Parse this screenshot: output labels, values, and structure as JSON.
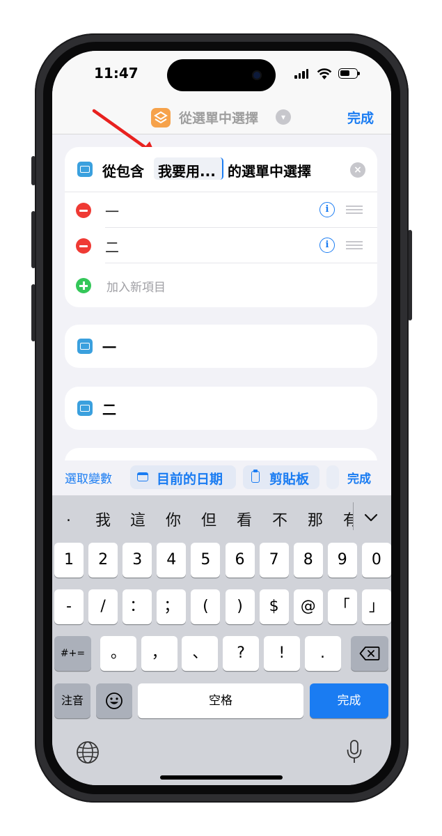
{
  "status_bar": {
    "time": "11:47"
  },
  "nav": {
    "title": "從選單中選擇",
    "done": "完成"
  },
  "header_card": {
    "prefix": "從包含",
    "variable": "我要用...",
    "suffix": "的選單中選擇"
  },
  "menu_items": [
    "一",
    "二"
  ],
  "add_item": "加入新項目",
  "section_cards": [
    "一",
    "二"
  ],
  "toolbar": {
    "select_variable": "選取變數",
    "current_date": "目前的日期",
    "clipboard": "剪貼板",
    "done": "完成"
  },
  "candidates": [
    ".",
    "我",
    "這",
    "你",
    "但",
    "看",
    "不",
    "那",
    "有"
  ],
  "keys": {
    "row1": [
      "1",
      "2",
      "3",
      "4",
      "5",
      "6",
      "7",
      "8",
      "9",
      "0"
    ],
    "row2": [
      "-",
      "/",
      "：",
      "；",
      "(",
      ")",
      "$",
      "@",
      "「",
      "」"
    ],
    "row3_left": "#+=",
    "row3": [
      "。",
      "，",
      "、",
      "?",
      "!",
      "."
    ],
    "zhuyin": "注音",
    "space": "空格",
    "return": "完成"
  },
  "colors": {
    "accent": "#1a7cf2",
    "delete": "#ef3a34",
    "add": "#34c759",
    "app_icon": "#f6a24b"
  }
}
